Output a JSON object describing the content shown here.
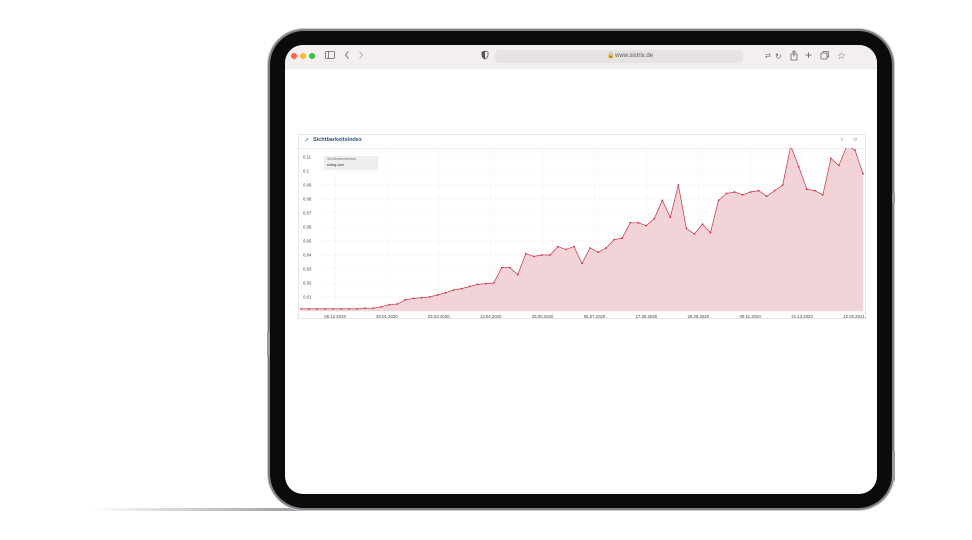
{
  "browser": {
    "traffic_lights": [
      "#fe5f57",
      "#febc2e",
      "#28c840"
    ],
    "url": "www.sistrix.de",
    "icons": [
      "sidebar-icon",
      "back-icon",
      "forward-icon",
      "shield-icon",
      "translate-icon",
      "reload-icon",
      "share-icon",
      "new-tab-icon",
      "tabs-icon",
      "bookmark-icon"
    ]
  },
  "widget": {
    "title": "Sichtbarkeitsindex",
    "legend_label": "Sichtbarkeitsindex",
    "legend_domain": "sideg.com",
    "action_icons": [
      "info-icon",
      "settings-icon"
    ]
  },
  "chart_data": {
    "type": "area",
    "title": "Sichtbarkeitsindex",
    "xlabel": "",
    "ylabel": "",
    "ylim": [
      0,
      0.115
    ],
    "yticks": [
      0.01,
      0.02,
      0.03,
      0.04,
      0.05,
      0.06,
      0.07,
      0.08,
      0.09,
      0.1,
      0.11
    ],
    "ytick_labels": [
      "0.01",
      "0.02",
      "0.03",
      "0.04",
      "0.05",
      "0.06",
      "0.07",
      "0.08",
      "0.09",
      "0.1",
      "0.11"
    ],
    "xtick_labels": [
      "09.12.2019",
      "20.01.2020",
      "02.03.2020",
      "13.04.2020",
      "25.05.2020",
      "06.07.2020",
      "17.08.2020",
      "28.09.2020",
      "09.11.2020",
      "21.12.2020",
      "12.02.2021"
    ],
    "grid": true,
    "legend_position": "top-left",
    "line_color": "#c9344a",
    "fill_color": "#f2d3d8",
    "series": [
      {
        "name": "sideg.com",
        "values": [
          0.0015,
          0.0015,
          0.0015,
          0.0015,
          0.0015,
          0.0015,
          0.0015,
          0.0015,
          0.002,
          0.002,
          0.003,
          0.0045,
          0.005,
          0.008,
          0.009,
          0.0095,
          0.01,
          0.0115,
          0.013,
          0.015,
          0.016,
          0.0175,
          0.019,
          0.0195,
          0.02,
          0.031,
          0.031,
          0.026,
          0.041,
          0.039,
          0.04,
          0.04,
          0.046,
          0.044,
          0.046,
          0.034,
          0.045,
          0.042,
          0.045,
          0.051,
          0.052,
          0.063,
          0.063,
          0.061,
          0.066,
          0.079,
          0.067,
          0.09,
          0.059,
          0.055,
          0.062,
          0.056,
          0.079,
          0.084,
          0.085,
          0.083,
          0.085,
          0.086,
          0.082,
          0.086,
          0.09,
          0.118,
          0.103,
          0.087,
          0.086,
          0.083,
          0.109,
          0.104,
          0.118,
          0.115,
          0.098
        ]
      }
    ]
  }
}
